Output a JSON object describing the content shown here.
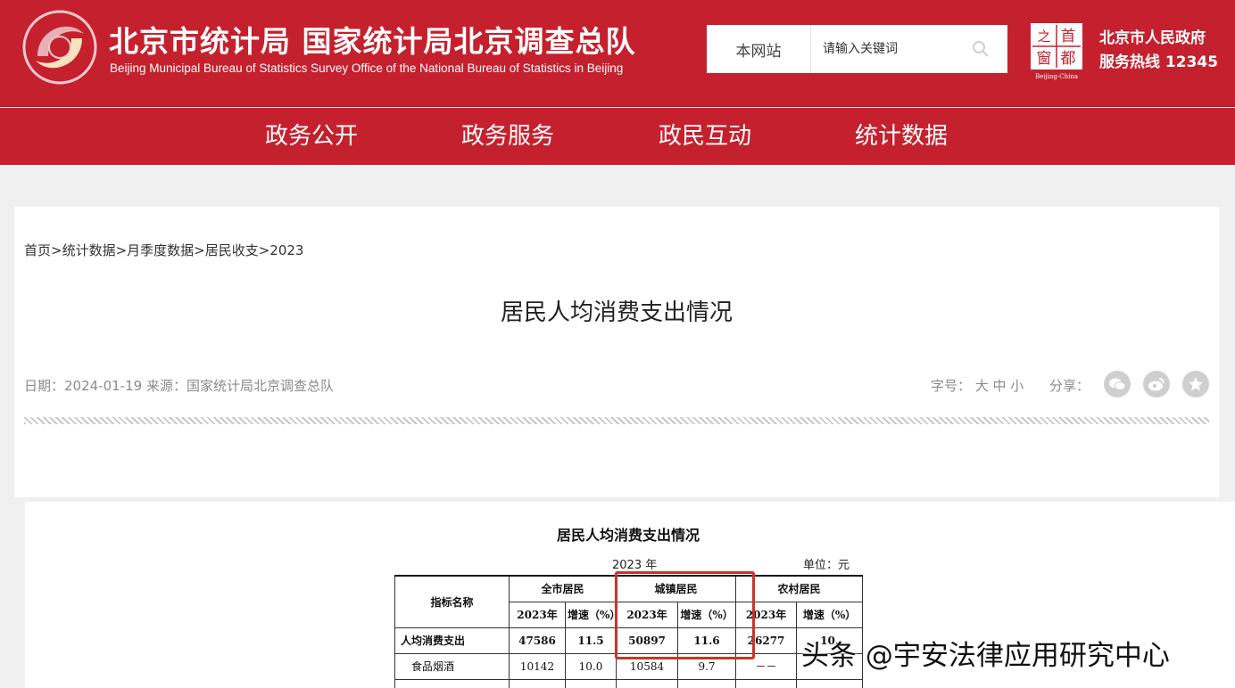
{
  "header": {
    "title_cn": "北京市统计局 国家统计局北京调查总队",
    "title_en": "Beijing Municipal Bureau of Statistics  Survey Office of the National Bureau of Statistics in Beijing",
    "search": {
      "scope": "本网站",
      "placeholder": "请输入关键词"
    },
    "capital_logo": {
      "chars": [
        "首",
        "之",
        "都",
        "窗"
      ],
      "caption": "Beijing-China"
    },
    "gov_name": "北京市人民政府",
    "hotline": "服务热线 12345",
    "brand_color": "#c5202d"
  },
  "nav": {
    "items": [
      {
        "label": "政务公开"
      },
      {
        "label": "政务服务"
      },
      {
        "label": "政民互动"
      },
      {
        "label": "统计数据"
      }
    ]
  },
  "article": {
    "breadcrumb": "首页>统计数据>月季度数据>居民收支>2023",
    "title": "居民人均消费支出情况",
    "meta": "日期：2024-01-19    来源：国家统计局北京调查总队",
    "font_size": "字号：  大  中  小",
    "share": "分享：",
    "share_icons": [
      "wechat-icon",
      "weibo-icon",
      "star-icon"
    ]
  },
  "document": {
    "title": "居民人均消费支出情况",
    "year": "2023 年",
    "unit": "单位：元",
    "table": {
      "header_name": "指标名称",
      "groups": [
        "全市居民",
        "城镇居民",
        "农村居民"
      ],
      "subheaders": [
        "2023年",
        "增速（%）",
        "2023年",
        "增速（%）",
        "2023年",
        "增速（%）"
      ],
      "rows": [
        {
          "label": "人均消费支出",
          "values": [
            "47586",
            "11.5",
            "50897",
            "11.6",
            "26277",
            "10."
          ]
        },
        {
          "label": "食品烟酒",
          "values": [
            "10142",
            "10.0",
            "10584",
            "9.7",
            "－－",
            ""
          ]
        }
      ]
    },
    "highlight_color": "#d0312d"
  },
  "watermark": "头条 @宇安法律应用研究中心"
}
